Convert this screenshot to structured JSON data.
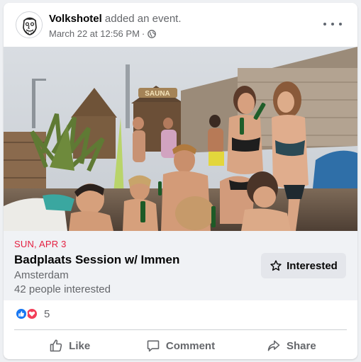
{
  "post": {
    "page_name": "Volkshotel",
    "action_text": "added an event.",
    "timestamp": "March 22 at 12:56 PM",
    "separator": "·",
    "audience_icon": "globe-icon",
    "more_icon": "more-options-icon"
  },
  "photo": {
    "sign_text": "SAUNA"
  },
  "event": {
    "date": "SUN, APR 3",
    "title": "Badplaats Session w/ Immen",
    "location": "Amsterdam",
    "interested_count_text": "42 people interested",
    "interested_button_label": "Interested",
    "date_color": "#e41e3f"
  },
  "reactions": {
    "icons": [
      "like-reaction-icon",
      "love-reaction-icon"
    ],
    "count": "5"
  },
  "actions": {
    "like_label": "Like",
    "comment_label": "Comment",
    "share_label": "Share"
  },
  "colors": {
    "brand_blue": "#1877f2",
    "love_red": "#f33e58",
    "secondary_text": "#65676b",
    "button_bg": "#e4e6eb"
  }
}
